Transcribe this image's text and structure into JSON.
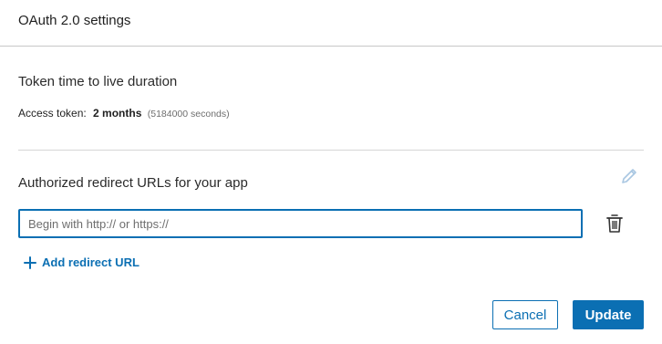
{
  "header": {
    "title": "OAuth 2.0 settings"
  },
  "token_ttl": {
    "title": "Token time to live duration",
    "access_token_label": "Access token:",
    "access_token_value": "2 months",
    "access_token_seconds": "(5184000 seconds)"
  },
  "redirect": {
    "title": "Authorized redirect URLs for your app",
    "input_value": "",
    "input_placeholder": "Begin with http:// or https://",
    "add_link_label": "Add redirect URL"
  },
  "icons": {
    "edit": "pencil-icon",
    "delete": "trash-icon",
    "add": "plus-icon"
  },
  "actions": {
    "cancel_label": "Cancel",
    "update_label": "Update"
  },
  "colors": {
    "accent": "#0b6fb3",
    "divider": "#d6d6d6",
    "icon_muted": "#a9c7e2"
  }
}
